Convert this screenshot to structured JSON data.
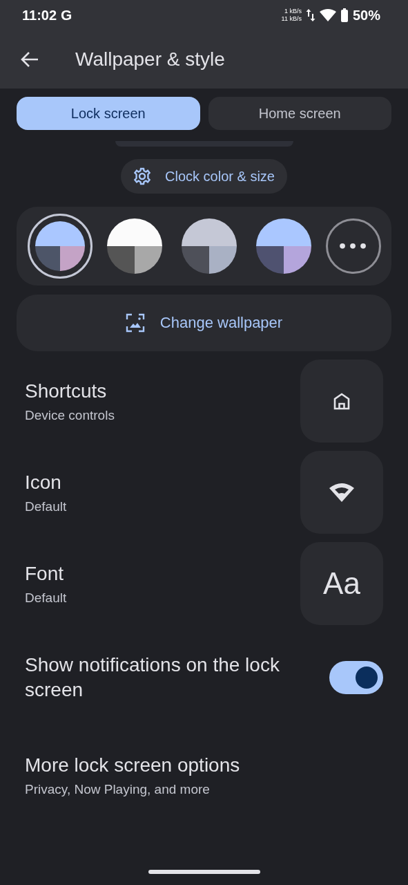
{
  "status_bar": {
    "time": "11:02",
    "carrier_logo": "G",
    "speed_up": "1 kB/s",
    "speed_down": "11 kB/s",
    "battery": "50%"
  },
  "app_bar": {
    "title": "Wallpaper & style"
  },
  "tabs": [
    {
      "label": "Lock screen",
      "selected": true
    },
    {
      "label": "Home screen",
      "selected": false
    }
  ],
  "clock_button": {
    "label": "Clock color & size"
  },
  "swatches": [
    {
      "kind": "colors",
      "selected": true,
      "segments": [
        {
          "color": "#aac7ff"
        },
        {
          "color": "#4d5568"
        },
        {
          "color": "#c4a3c6"
        }
      ]
    },
    {
      "kind": "colors",
      "selected": false,
      "segments": [
        {
          "color": "#fbfbfb"
        },
        {
          "color": "#555555"
        },
        {
          "color": "#a8a8a8"
        }
      ]
    },
    {
      "kind": "colors",
      "selected": false,
      "segments": [
        {
          "color": "#c5c8d6"
        },
        {
          "color": "#4e5059"
        },
        {
          "color": "#a9b1c4"
        }
      ]
    },
    {
      "kind": "colors",
      "selected": false,
      "segments": [
        {
          "color": "#aac7ff"
        },
        {
          "color": "#4f5270"
        },
        {
          "color": "#b4a5dc"
        }
      ]
    },
    {
      "kind": "more",
      "selected": false,
      "label": "•••"
    }
  ],
  "change_wallpaper": {
    "label": "Change wallpaper"
  },
  "settings": [
    {
      "kind": "tile",
      "title": "Shortcuts",
      "subtitle": "Device controls",
      "tile": {
        "kind": "home"
      }
    },
    {
      "kind": "tile",
      "title": "Icon",
      "subtitle": "Default",
      "tile": {
        "kind": "wifi"
      }
    },
    {
      "kind": "tile",
      "title": "Font",
      "subtitle": "Default",
      "tile": {
        "kind": "text",
        "text": "Aa"
      }
    },
    {
      "kind": "toggle",
      "title": "Show notifications on the lock screen",
      "on": true
    },
    {
      "kind": "plain",
      "title": "More lock screen options",
      "subtitle": "Privacy, Now Playing, and more"
    }
  ]
}
